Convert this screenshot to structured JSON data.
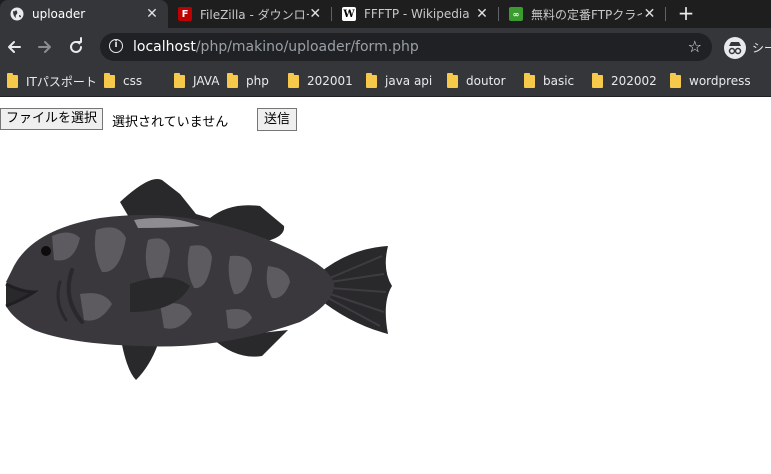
{
  "tabs": [
    {
      "title": "uploader",
      "icon": "globe-icon",
      "active": true
    },
    {
      "title": "FileZilla - ダウンロード",
      "icon": "filezilla-icon",
      "active": false
    },
    {
      "title": "FFFTP - Wikipedia",
      "icon": "wikipedia-icon",
      "active": false
    },
    {
      "title": "無料の定番FTPクライ",
      "icon": "site-icon",
      "active": false
    }
  ],
  "toolbar": {
    "url_host": "localhost",
    "url_path": "/php/makino/uploader/form.php",
    "profile_label": "シー"
  },
  "bookmarks": [
    "ITパスポート",
    "css",
    "JAVA",
    "php",
    "202001",
    "java api",
    "doutor",
    "basic",
    "202002",
    "wordpress"
  ],
  "form": {
    "file_button_label": "ファイルを選択",
    "file_status": "選択されていません",
    "submit_label": "送信"
  },
  "colors": {
    "tabstrip": "#1e1e1f",
    "toolbar": "#35363a",
    "omnibox": "#202124",
    "folder": "#f6c94b",
    "fish_body": "#3a383d",
    "fish_spots": "#5d5a60",
    "fish_fins": "#29282b"
  }
}
